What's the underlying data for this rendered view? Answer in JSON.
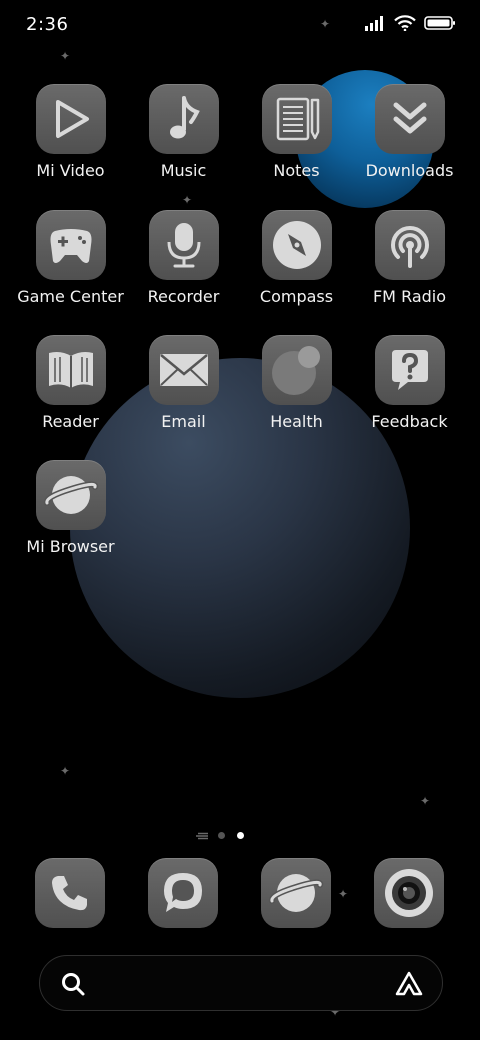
{
  "status_bar": {
    "time": "2:36"
  },
  "apps": [
    {
      "label": "Mi Video"
    },
    {
      "label": "Music"
    },
    {
      "label": "Notes"
    },
    {
      "label": "Downloads"
    },
    {
      "label": "Game Center"
    },
    {
      "label": "Recorder"
    },
    {
      "label": "Compass"
    },
    {
      "label": "FM Radio"
    },
    {
      "label": "Reader"
    },
    {
      "label": "Email"
    },
    {
      "label": "Health"
    },
    {
      "label": "Feedback"
    },
    {
      "label": "Mi Browser"
    }
  ],
  "pager": {
    "pages": 2,
    "current": 2
  },
  "dock": [
    "phone-icon",
    "messaging-icon",
    "browser-icon",
    "camera-icon"
  ],
  "colors": {
    "tile": "#5c5c5c",
    "glyph": "#d9d9d9",
    "accent_blue": "#0e5f99"
  }
}
